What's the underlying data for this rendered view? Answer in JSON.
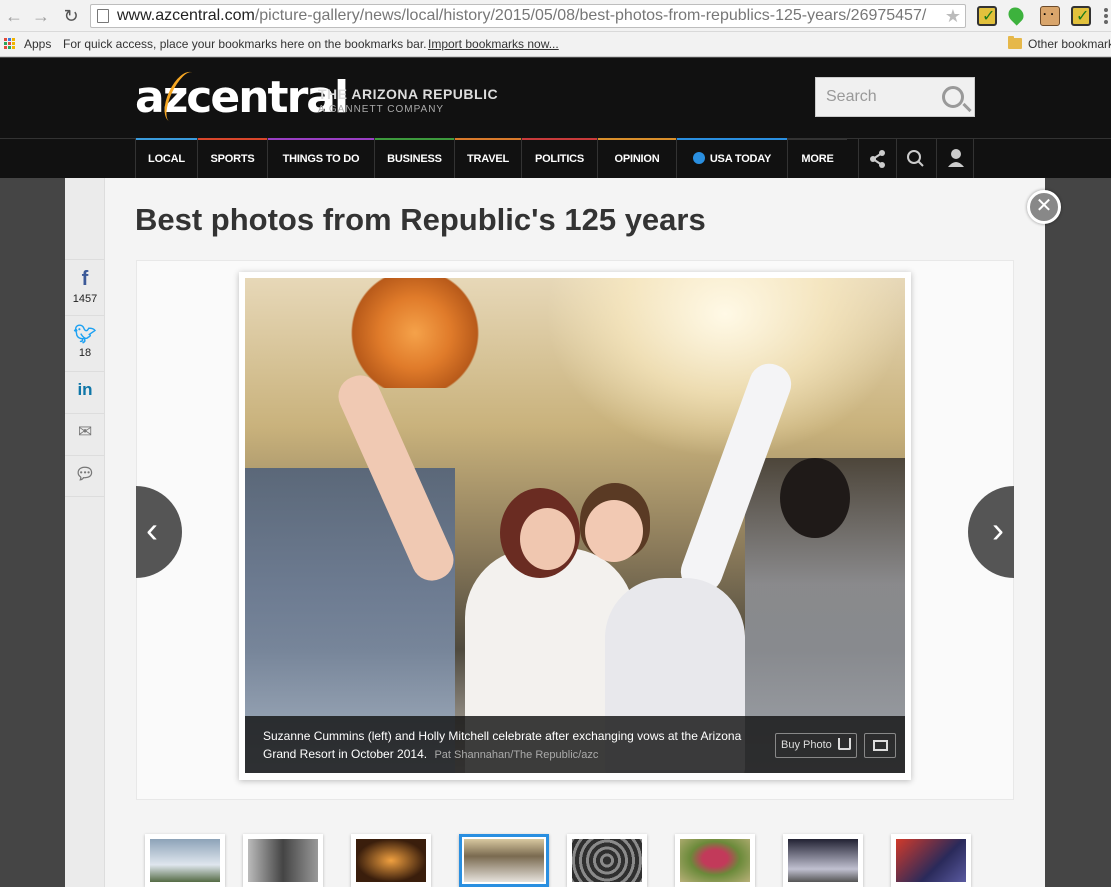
{
  "browser": {
    "url_host": "www.azcentral.com",
    "url_path": "/picture-gallery/news/local/history/2015/05/08/best-photos-from-republics-125-years/26975457/",
    "back_icon": "arrow-left-icon",
    "forward_icon": "arrow-right-icon",
    "reload_icon": "reload-icon"
  },
  "bookmarks": {
    "apps_label": "Apps",
    "hint": "For quick access, place your bookmarks here on the bookmarks bar.",
    "import_link": "Import bookmarks now...",
    "other_label": "Other bookmarks"
  },
  "site": {
    "logo": "azcentral",
    "publisher": "THE ARIZONA REPUBLIC",
    "publisher_sub": "A GANNETT COMPANY",
    "search_placeholder": "Search",
    "accent": "#f5a623"
  },
  "nav": [
    {
      "label": "LOCAL",
      "color": "#3a9bdc"
    },
    {
      "label": "SPORTS",
      "color": "#d9462b"
    },
    {
      "label": "THINGS TO DO",
      "color": "#9a3fc4"
    },
    {
      "label": "BUSINESS",
      "color": "#3d9a3d"
    },
    {
      "label": "TRAVEL",
      "color": "#d97a2b"
    },
    {
      "label": "POLITICS",
      "color": "#c93b3b"
    },
    {
      "label": "OPINION",
      "color": "#d98f2b"
    },
    {
      "label": "USA TODAY",
      "color": "#2a8fe0"
    },
    {
      "label": "MORE",
      "color": "#333333"
    }
  ],
  "gallery": {
    "title": "Best photos from Republic's 125 years",
    "share": {
      "facebook_count": "1457",
      "twitter_count": "18"
    },
    "caption": "Suzanne Cummins (left) and Holly Mitchell celebrate after exchanging vows at the Arizona Grand Resort in October 2014.",
    "credit": "Pat Shannahan/The Republic/azc",
    "buy_label": "Buy Photo"
  },
  "thumbnails": [
    {
      "name": "mountains",
      "colors": [
        "#8da3b8",
        "#dfe6ee"
      ]
    },
    {
      "name": "portrait-bw",
      "colors": [
        "#444444",
        "#bbbbbb"
      ]
    },
    {
      "name": "candles",
      "colors": [
        "#3a1e0c",
        "#f0a040"
      ]
    },
    {
      "name": "wedding",
      "colors": [
        "#7a6a50",
        "#e6e2dc"
      ],
      "active": true
    },
    {
      "name": "labyrinth",
      "colors": [
        "#2f2f2f",
        "#8a8a8a"
      ]
    },
    {
      "name": "red-figure",
      "colors": [
        "#6b8a3a",
        "#c23a5a"
      ]
    },
    {
      "name": "team",
      "colors": [
        "#222233",
        "#c0c0d0"
      ]
    },
    {
      "name": "stage",
      "colors": [
        "#2a2a5a",
        "#d23a2a"
      ]
    }
  ]
}
